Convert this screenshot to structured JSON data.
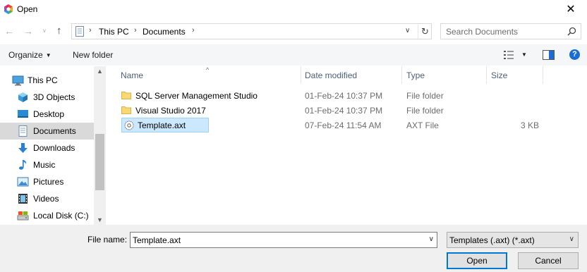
{
  "window": {
    "title": "Open",
    "close_glyph": "✕"
  },
  "nav": {
    "back": "←",
    "forward": "→",
    "recent": "∨",
    "up": "↑"
  },
  "address": {
    "crumbs": [
      "This PC",
      "Documents"
    ],
    "sep": "›",
    "dropdown": "∨",
    "refresh": "↻"
  },
  "search": {
    "placeholder": "Search Documents"
  },
  "toolbar": {
    "organize_label": "Organize",
    "caret": "▼",
    "new_folder_label": "New folder",
    "help_glyph": "?"
  },
  "sidebar": {
    "items": [
      {
        "label": "This PC",
        "icon": "pc-icon"
      },
      {
        "label": "3D Objects",
        "icon": "cube-icon"
      },
      {
        "label": "Desktop",
        "icon": "desktop-icon"
      },
      {
        "label": "Documents",
        "icon": "document-icon"
      },
      {
        "label": "Downloads",
        "icon": "download-icon"
      },
      {
        "label": "Music",
        "icon": "music-icon"
      },
      {
        "label": "Pictures",
        "icon": "picture-icon"
      },
      {
        "label": "Videos",
        "icon": "video-icon"
      },
      {
        "label": "Local Disk (C:)",
        "icon": "disk-icon"
      }
    ],
    "selected": "Documents",
    "scroll_up": "▲",
    "scroll_down": "▼"
  },
  "columns": {
    "name": "Name",
    "date": "Date modified",
    "type": "Type",
    "size": "Size",
    "sort_glyph": "^"
  },
  "files": [
    {
      "name": "SQL Server Management Studio",
      "date": "01-Feb-24 10:37 PM",
      "type": "File folder",
      "size": "",
      "icon": "folder-icon"
    },
    {
      "name": "Visual Studio 2017",
      "date": "01-Feb-24 10:37 PM",
      "type": "File folder",
      "size": "",
      "icon": "folder-icon"
    },
    {
      "name": "Template.axt",
      "date": "07-Feb-24 11:54 AM",
      "type": "AXT File",
      "size": "3 KB",
      "icon": "axt-file-icon"
    }
  ],
  "footer": {
    "filename_label": "File name:",
    "filename_value": "Template.axt",
    "dropdown": "∨",
    "filetype_value": "Templates (.axt) (*.axt)",
    "open_label": "Open",
    "cancel_label": "Cancel"
  },
  "colors": {
    "selection": "#cce8ff",
    "selection_border": "#99d1ff",
    "accent": "#0078d7",
    "folder": "#f8d775"
  }
}
